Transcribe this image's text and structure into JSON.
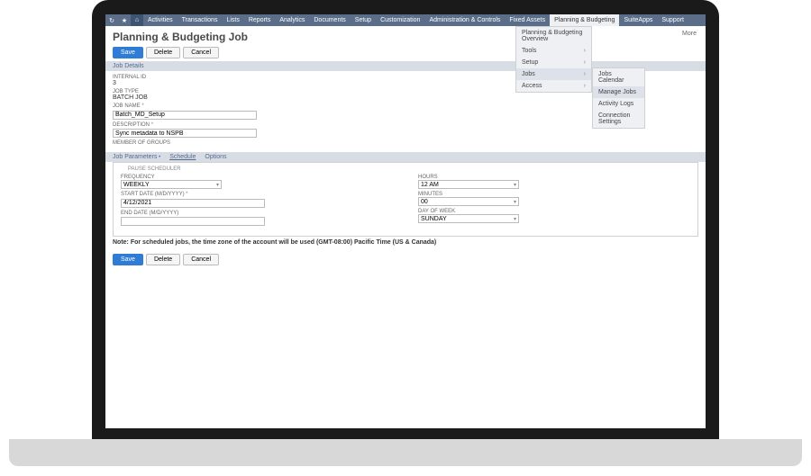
{
  "topnav": {
    "items": [
      "Activities",
      "Transactions",
      "Lists",
      "Reports",
      "Analytics",
      "Documents",
      "Setup",
      "Customization",
      "Administration & Controls",
      "Fixed Assets",
      "Planning & Budgeting",
      "SuiteApps",
      "Support"
    ],
    "active_index": 10
  },
  "more_label": "More",
  "dropdown1": {
    "items": [
      "Planning & Budgeting Overview",
      "Tools",
      "Setup",
      "Jobs",
      "Access"
    ],
    "hover_index": 3
  },
  "dropdown2": {
    "items": [
      "Jobs Calendar",
      "Manage Jobs",
      "Activity Logs",
      "Connection Settings"
    ],
    "hover_index": 1
  },
  "page": {
    "title": "Planning & Budgeting Job",
    "save_label": "Save",
    "delete_label": "Delete",
    "cancel_label": "Cancel"
  },
  "subtab": "Job Details",
  "fields": {
    "internal_id_label": "INTERNAL ID",
    "internal_id_value": "3",
    "job_type_label": "JOB TYPE",
    "job_type_value": "BATCH JOB",
    "job_name_label": "JOB NAME",
    "job_name_value": "Batch_MD_Setup",
    "description_label": "DESCRIPTION",
    "description_value": "Sync metadata to NSPB",
    "member_label": "MEMBER OF GROUPS"
  },
  "tabs": {
    "params": "Job Parameters",
    "schedule": "Schedule",
    "options": "Options"
  },
  "schedule": {
    "pause_label": "PAUSE SCHEDULER",
    "frequency_label": "FREQUENCY",
    "frequency_value": "WEEKLY",
    "start_date_label": "START DATE (M/D/YYYY)",
    "start_date_value": "4/12/2021",
    "end_date_label": "END DATE (M/D/YYYY)",
    "end_date_value": "",
    "hours_label": "HOURS",
    "hours_value": "12 AM",
    "minutes_label": "MINUTES",
    "minutes_value": "00",
    "dow_label": "DAY OF WEEK",
    "dow_value": "SUNDAY"
  },
  "note": "Note: For scheduled jobs, the time zone of the account will be used (GMT-08:00) Pacific Time (US & Canada)"
}
